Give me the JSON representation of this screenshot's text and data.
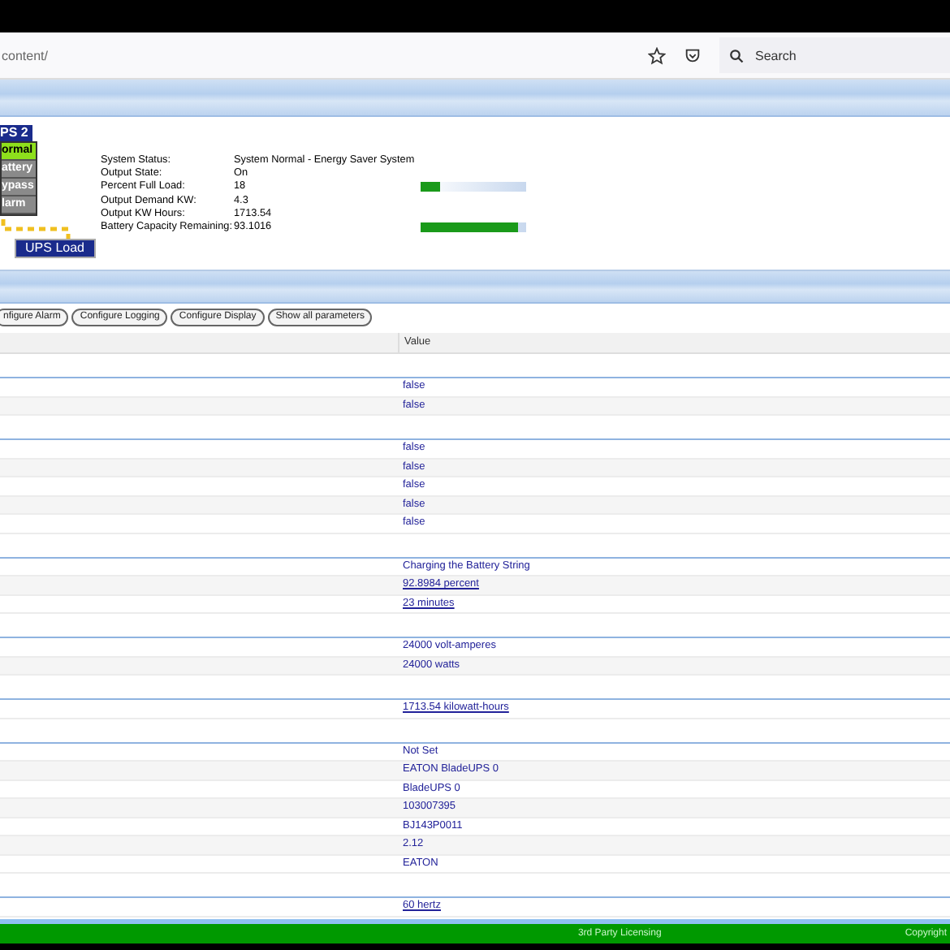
{
  "browser": {
    "url": "content/",
    "search": {
      "placeholder": "Search"
    }
  },
  "ups": {
    "title": "PS 2",
    "lights": [
      {
        "label": "ormal",
        "on": true
      },
      {
        "label": "attery",
        "on": false
      },
      {
        "label": "ypass",
        "on": false
      },
      {
        "label": "larm",
        "on": false
      }
    ],
    "load_label": "UPS Load"
  },
  "status": [
    {
      "label": "System Status:",
      "value": "System Normal - Energy Saver System"
    },
    {
      "label": "Output State:",
      "value": "On"
    },
    {
      "label": "Percent Full Load:",
      "value": "18",
      "level": 0.18
    },
    {
      "label": "Output Demand KW:",
      "value": "4.3"
    },
    {
      "label": "Output KW Hours:",
      "value": "1713.54"
    },
    {
      "label": "Battery Capacity Remaining:",
      "value": "93.1016",
      "level": 0.93
    }
  ],
  "buttons": [
    "nfigure Alarm",
    "Configure Logging",
    "Configure Display",
    "Show all parameters"
  ],
  "table": {
    "columns": [
      "Value"
    ],
    "groups": [
      {
        "rows": [
          {
            "value": "false",
            "link": false
          },
          {
            "value": "false",
            "link": false
          }
        ]
      },
      {
        "rows": [
          {
            "value": "false",
            "link": false
          },
          {
            "value": "false",
            "link": false
          },
          {
            "value": "false",
            "link": false
          },
          {
            "value": "false",
            "link": false
          },
          {
            "value": "false",
            "link": false
          }
        ]
      },
      {
        "rows": [
          {
            "value": "Charging the Battery String",
            "link": false
          },
          {
            "value": "92.8984 percent",
            "link": true
          },
          {
            "value": "23 minutes",
            "link": true
          }
        ]
      },
      {
        "rows": [
          {
            "value": "24000 volt-amperes",
            "link": false
          },
          {
            "value": "24000 watts",
            "link": false
          }
        ]
      },
      {
        "rows": [
          {
            "value": "1713.54 kilowatt-hours",
            "link": true
          }
        ]
      },
      {
        "rows": [
          {
            "value": "Not Set",
            "link": false
          },
          {
            "value": "EATON BladeUPS 0",
            "link": false
          },
          {
            "value": "BladeUPS 0",
            "link": false
          },
          {
            "value": "103007395",
            "link": false
          },
          {
            "value": "BJ143P0011",
            "link": false
          },
          {
            "value": "2.12",
            "link": false
          },
          {
            "value": "EATON",
            "link": false
          }
        ]
      },
      {
        "rows": [
          {
            "value": "60 hertz",
            "link": true
          }
        ]
      }
    ]
  },
  "footer": {
    "links": [
      "3rd Party Licensing",
      "Copyright"
    ]
  }
}
